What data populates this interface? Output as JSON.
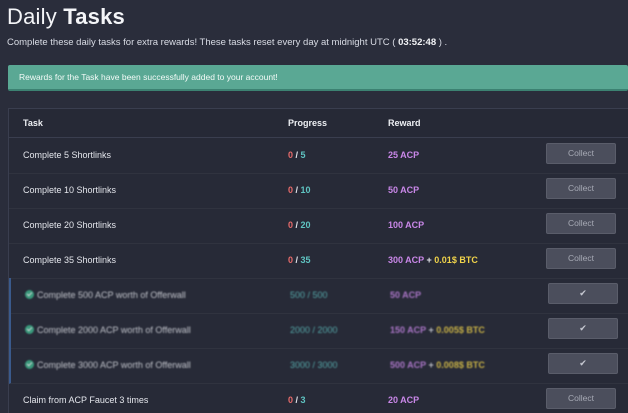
{
  "header": {
    "title_prefix": "Daily ",
    "title_bold": "Tasks",
    "subtitle_before": "Complete these daily tasks for extra rewards! These tasks reset every day at midnight UTC ( ",
    "timer": "03:52:48",
    "subtitle_after": " ) ."
  },
  "alert": {
    "message": "Rewards for the Task have been successfully added to your account!"
  },
  "table": {
    "columns": [
      "Task",
      "Progress",
      "Reward"
    ],
    "rows": [
      {
        "task": "Complete 5 Shortlinks",
        "progress_done": "0",
        "sep": " / ",
        "progress_total": "5",
        "reward": "25 ACP",
        "button": "Collect"
      },
      {
        "task": "Complete 10 Shortlinks",
        "progress_done": "0",
        "sep": " / ",
        "progress_total": "10",
        "reward": "50 ACP",
        "button": "Collect"
      },
      {
        "task": "Complete 20 Shortlinks",
        "progress_done": "0",
        "sep": " / ",
        "progress_total": "20",
        "reward": "100 ACP",
        "button": "Collect"
      },
      {
        "task": "Complete 35 Shortlinks",
        "progress_done": "0",
        "sep": " / ",
        "progress_total": "35",
        "reward": "300 ACP",
        "plus": " + ",
        "reward_btc": "0.01$ BTC",
        "button": "Collect"
      },
      {
        "task": "Complete 500 ACP worth of Offerwall",
        "progress": "500 / 500",
        "reward": "50 ACP",
        "button": "✔"
      },
      {
        "task": "Complete 2000 ACP worth of Offerwall",
        "progress": "2000 / 2000",
        "reward": "150 ACP",
        "plus": " + ",
        "reward_btc": "0.005$ BTC",
        "button": "✔"
      },
      {
        "task": "Complete 3000 ACP worth of Offerwall",
        "progress": "3000 / 3000",
        "reward": "500 ACP",
        "plus": " + ",
        "reward_btc": "0.008$ BTC",
        "button": "✔"
      },
      {
        "task": "Claim from ACP Faucet 3 times",
        "progress_done": "0",
        "sep": " / ",
        "progress_total": "3",
        "reward": "20 ACP",
        "button": "Collect"
      }
    ]
  },
  "colors": {
    "background": "#2a2d3b",
    "alert": "#5aa894",
    "progress_zero": "#e86b6b",
    "progress_total": "#5fc4c2",
    "reward_acp": "#c987e8",
    "reward_btc": "#f0d34a",
    "check_icon": "#3fb58d"
  },
  "icons": {
    "completed": "check-circle-icon",
    "collected": "check-icon"
  }
}
